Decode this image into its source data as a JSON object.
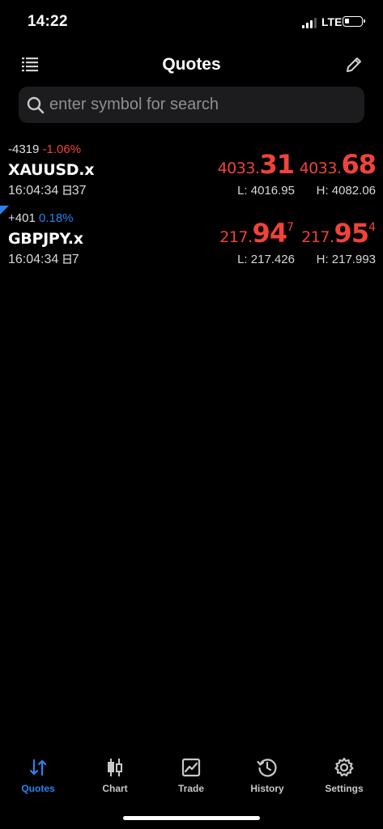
{
  "status_bar": {
    "time": "14:22",
    "network": "LTE"
  },
  "header": {
    "title": "Quotes"
  },
  "search": {
    "placeholder": "enter symbol for search"
  },
  "quotes": [
    {
      "change_points": "-4319",
      "change_percent": "-1.06%",
      "change_color": "#f0433a",
      "symbol": "XAUUSD.x",
      "time": "16:04:34",
      "spread_icon": "spread-icon",
      "spread": "37",
      "bid": {
        "small": "4033.",
        "big": "31",
        "sup": ""
      },
      "ask": {
        "small": "4033.",
        "big": "68",
        "sup": ""
      },
      "low": "L: 4016.95",
      "high": "H: 4082.06"
    },
    {
      "change_points": "+401",
      "change_percent": "0.18%",
      "change_color": "#2a82f0",
      "symbol": "GBPJPY.x",
      "time": "16:04:34",
      "spread_icon": "spread-icon",
      "spread": "7",
      "bid": {
        "small": "217.",
        "big": "94",
        "sup": "7"
      },
      "ask": {
        "small": "217.",
        "big": "95",
        "sup": "4"
      },
      "low": "L: 217.426",
      "high": "H: 217.993"
    }
  ],
  "price_color": "#f0433a",
  "tabs": [
    {
      "label": "Quotes",
      "icon": "quotes-arrows-icon",
      "active": true
    },
    {
      "label": "Chart",
      "icon": "candlestick-icon",
      "active": false
    },
    {
      "label": "Trade",
      "icon": "trade-chart-icon",
      "active": false
    },
    {
      "label": "History",
      "icon": "history-clock-icon",
      "active": false
    },
    {
      "label": "Settings",
      "icon": "gear-icon",
      "active": false
    }
  ],
  "accent_color": "#2a82f0"
}
